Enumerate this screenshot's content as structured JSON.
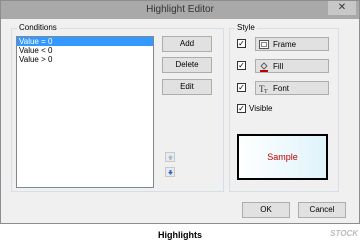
{
  "window": {
    "title": "Highlight Editor",
    "close_glyph": "✕"
  },
  "conditions": {
    "label": "Conditions",
    "items": [
      "Value = 0",
      "Value < 0",
      "Value > 0"
    ],
    "selected_index": 0,
    "buttons": {
      "add": "Add",
      "delete": "Delete",
      "edit": "Edit"
    },
    "move_up_icon": "arrow-up-icon",
    "move_down_icon": "arrow-down-icon"
  },
  "style": {
    "label": "Style",
    "frame": {
      "label": "Frame",
      "checked": true,
      "icon": "frame-icon"
    },
    "fill": {
      "label": "Fill",
      "checked": true,
      "icon": "fill-bucket-icon"
    },
    "font": {
      "label": "Font",
      "checked": true,
      "icon": "font-icon"
    },
    "visible": {
      "label": "Visible",
      "checked": true
    },
    "sample": {
      "text": "Sample",
      "text_color": "#c00000"
    }
  },
  "footer": {
    "ok": "OK",
    "cancel": "Cancel"
  },
  "caption": "Highlights",
  "watermark": "STOCK"
}
